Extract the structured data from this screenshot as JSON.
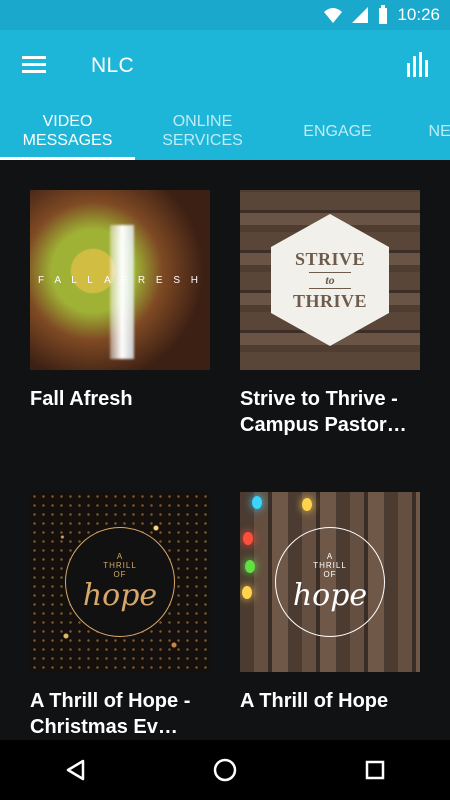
{
  "status_bar": {
    "time": "10:26",
    "icons": [
      "wifi-icon",
      "signal-icon",
      "battery-icon"
    ]
  },
  "app_bar": {
    "title": "NLC",
    "menu_icon": "menu-icon",
    "stats_icon": "bar-chart-icon"
  },
  "tabs": [
    {
      "label": "Video\nMessages",
      "active": true
    },
    {
      "label": "Online\nServices",
      "active": false
    },
    {
      "label": "Engage",
      "active": false
    },
    {
      "label": "Nex",
      "active": false
    }
  ],
  "cards": [
    {
      "title": "Fall Afresh",
      "thumbnail_text": [
        "F A L L",
        "A F R E S H"
      ]
    },
    {
      "title": "Strive to Thrive - Campus Pastor…",
      "thumbnail_text": [
        "STRIVE",
        "to",
        "THRIVE"
      ]
    },
    {
      "title": "A Thrill of Hope - Christmas Ev…",
      "thumbnail_text": [
        "A",
        "THRILL",
        "of",
        "hope"
      ]
    },
    {
      "title": "A Thrill of Hope",
      "thumbnail_text": [
        "A",
        "THRILL",
        "of",
        "hope"
      ]
    }
  ],
  "colors": {
    "primary": "#1eb6d8",
    "status": "#1aa9cc",
    "background": "#111214"
  },
  "navigation": {
    "icons": [
      "back-icon",
      "home-icon",
      "recents-icon"
    ]
  }
}
